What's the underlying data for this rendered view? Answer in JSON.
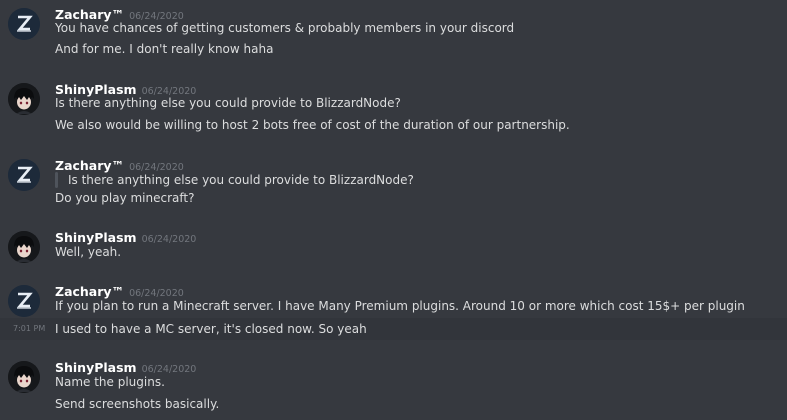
{
  "messages": [
    {
      "author": "Zachary™",
      "timestamp": "06/24/2020",
      "lines": [
        "You have chances of getting customers & probably members in your discord",
        "And for me. I don't really know haha"
      ]
    },
    {
      "author": "ShinyPlasm",
      "timestamp": "06/24/2020",
      "lines": [
        "Is there anything else you could provide to BlizzardNode?",
        "We also would be willing to host 2 bots free of cost of the duration of our partnership."
      ]
    },
    {
      "author": "Zachary™",
      "timestamp": "06/24/2020",
      "quote": "Is there anything else you could provide to BlizzardNode?",
      "lines": [
        "Do you play minecraft?"
      ]
    },
    {
      "author": "ShinyPlasm",
      "timestamp": "06/24/2020",
      "lines": [
        "Well, yeah."
      ]
    },
    {
      "author": "Zachary™",
      "timestamp": "06/24/2020",
      "lines": [
        "If you plan to run a Minecraft server. I have Many Premium plugins. Around 10 or more which cost 15$+ per plugin"
      ],
      "followup": {
        "time": "7:01 PM",
        "text": "I used to have a MC server, it's closed now. So yeah"
      }
    },
    {
      "author": "ShinyPlasm",
      "timestamp": "06/24/2020",
      "lines": [
        "Name the plugins.",
        "Send screenshots basically."
      ]
    }
  ],
  "colors": {
    "background": "#36393f",
    "hover_background": "#32353b",
    "username": "#ffffff",
    "timestamp": "#72767d",
    "text": "#dcddde",
    "quote_bar": "#4f545c"
  },
  "icons": {
    "zachary_avatar": "z-logo-avatar-icon",
    "shinyplasm_avatar": "anime-character-avatar-icon"
  }
}
